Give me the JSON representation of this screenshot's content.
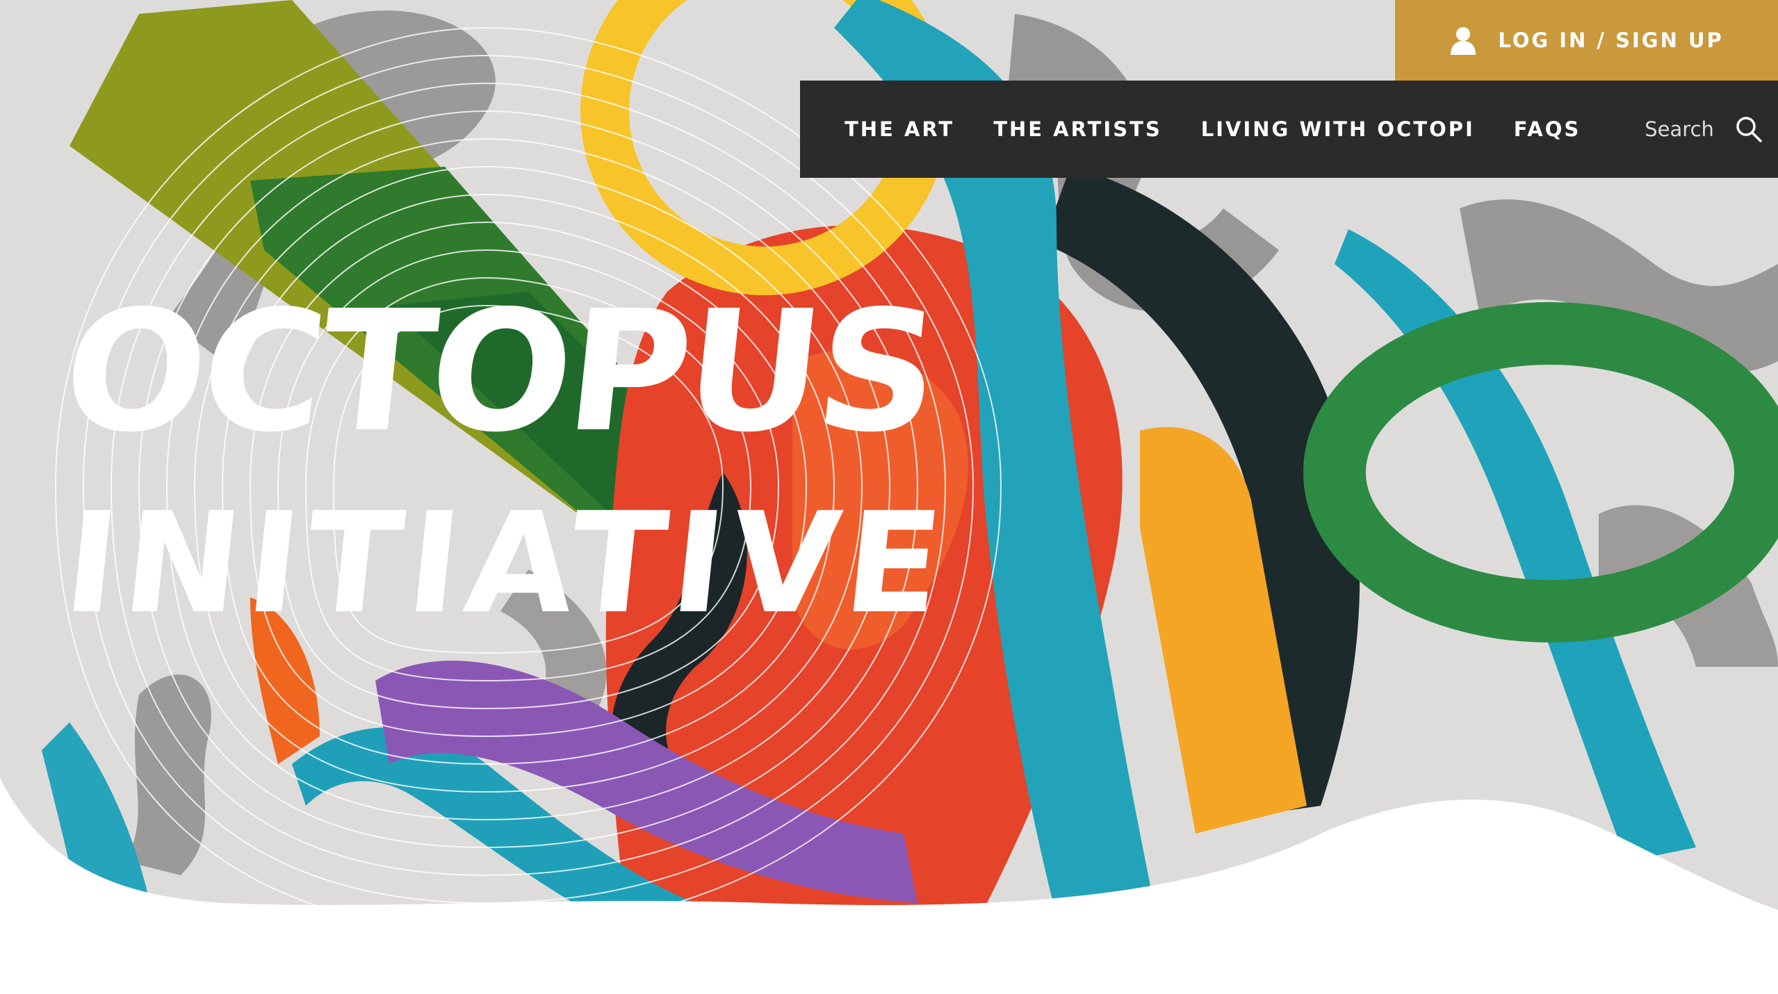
{
  "header": {
    "login_label": "LOG IN / SIGN UP",
    "login_icon": "user-icon",
    "accent_color": "#c9993b",
    "nav_background": "#2b2b2b"
  },
  "nav": {
    "items": [
      {
        "label": "THE ART"
      },
      {
        "label": "THE ARTISTS"
      },
      {
        "label": "LIVING WITH OCTOPI"
      },
      {
        "label": "FAQS"
      }
    ],
    "search": {
      "label": "Search",
      "icon": "search-icon"
    }
  },
  "hero": {
    "title_line1": "OCTOPUS",
    "title_line2": "INITIATIVE"
  }
}
